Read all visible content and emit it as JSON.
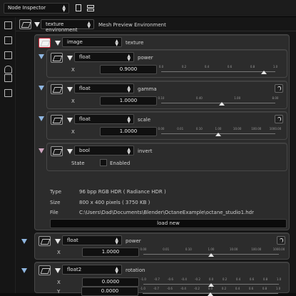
{
  "topbar": {
    "inspector": "Node Inspector",
    "icons": [
      "document-icon",
      "split-view-icon"
    ]
  },
  "sidebar": {
    "icons": [
      "settings-icon",
      "render-icon",
      "film-icon",
      "teapot-icon",
      "image-icon",
      "grid-icon"
    ]
  },
  "environment": {
    "type": "texture environment",
    "name": "Mesh Preview Environment"
  },
  "texture": {
    "type": "image",
    "label": "texture",
    "power": {
      "type": "float",
      "label": "power",
      "field": "X",
      "value": "0.9000",
      "ticks": [
        "0.0",
        "0.2",
        "0.4",
        "0.6",
        "0.8",
        "1.0"
      ],
      "level": 0.9
    },
    "gamma": {
      "type": "float",
      "label": "gamma",
      "field": "X",
      "value": "1.0000",
      "ticks": [
        "0.10",
        "0.40",
        "1.00",
        "8.00"
      ],
      "level": 0.53
    },
    "scale": {
      "type": "float",
      "label": "scale",
      "field": "X",
      "value": "1.0000",
      "ticks": [
        "0.00",
        "0.01",
        "0.10",
        "1.00",
        "10.00",
        "100.00",
        "1000.00"
      ],
      "level": 0.5
    },
    "invert": {
      "type": "bool",
      "label": "invert",
      "state_label": "State",
      "enabled_label": "Enabled",
      "enabled": false
    },
    "info": {
      "type_label": "Type",
      "type_value": "96 bpp RGB HDR ( Radiance HDR )",
      "size_label": "Size",
      "size_value": "800 x 400 pixels ( 3750 KB )",
      "file_label": "File",
      "file_value": "C:\\Users\\Dad\\Documents\\Blender\\OctaneExample\\octane_studio1.hdr"
    },
    "load_button": "load new"
  },
  "power": {
    "type": "float",
    "label": "power",
    "field": "X",
    "value": "1.0000",
    "ticks": [
      "0.00",
      "0.01",
      "0.10",
      "1.00",
      "10.00",
      "100.00",
      "1000.00"
    ],
    "level": 0.5
  },
  "rotation": {
    "type": "float2",
    "label": "rotation",
    "rows": [
      {
        "field": "X",
        "value": "0.0000",
        "level": 0.5
      },
      {
        "field": "Y",
        "value": "0.0000",
        "level": 0.5
      }
    ],
    "ticks": [
      "-1.0",
      "-0.7",
      "-0.6",
      "-0.4",
      "-0.2",
      "0.0",
      "0.2",
      "0.4",
      "0.6",
      "0.8",
      "1.0"
    ]
  },
  "colors": {
    "background": "#161616",
    "panel": "#2c2c2c",
    "input": "#101010"
  }
}
